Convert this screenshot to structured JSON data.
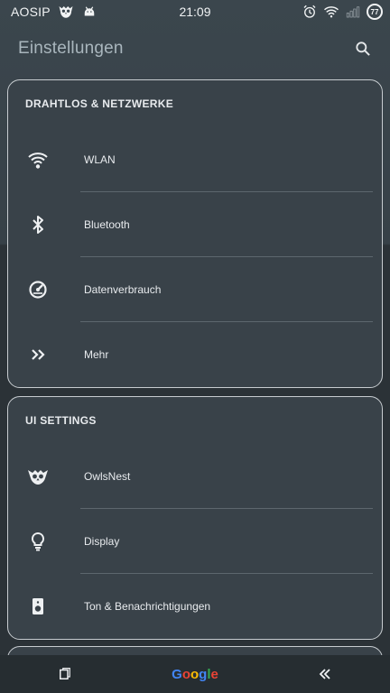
{
  "status_bar": {
    "carrier": "AOSIP",
    "time": "21:09",
    "battery": "77",
    "icons": [
      "owl-icon",
      "android-icon",
      "alarm-icon",
      "wifi-icon",
      "signal-icon",
      "battery-icon"
    ]
  },
  "app_bar": {
    "title": "Einstellungen",
    "search_icon": "search-icon"
  },
  "sections": [
    {
      "header": "DRAHTLOS & NETZWERKE",
      "items": [
        {
          "label": "WLAN",
          "icon": "wifi-icon"
        },
        {
          "label": "Bluetooth",
          "icon": "bluetooth-icon"
        },
        {
          "label": "Datenverbrauch",
          "icon": "data-usage-icon"
        },
        {
          "label": "Mehr",
          "icon": "more-chevrons-icon"
        }
      ]
    },
    {
      "header": "UI SETTINGS",
      "items": [
        {
          "label": "OwlsNest",
          "icon": "owl-icon"
        },
        {
          "label": "Display",
          "icon": "lightbulb-icon"
        },
        {
          "label": "Ton & Benachrichtigungen",
          "icon": "speaker-icon"
        }
      ]
    }
  ],
  "nav_bar": {
    "recents_icon": "recents-icon",
    "google_label": "Google",
    "back_icon": "back-chevrons-icon"
  },
  "colors": {
    "background": "#2b3237",
    "card": "#394249",
    "card_border": "#c7ccd0",
    "title": "#a9b6bd",
    "google_blue": "#4285F4",
    "google_red": "#EA4335",
    "google_yellow": "#FBBC05",
    "google_green": "#34A853"
  }
}
